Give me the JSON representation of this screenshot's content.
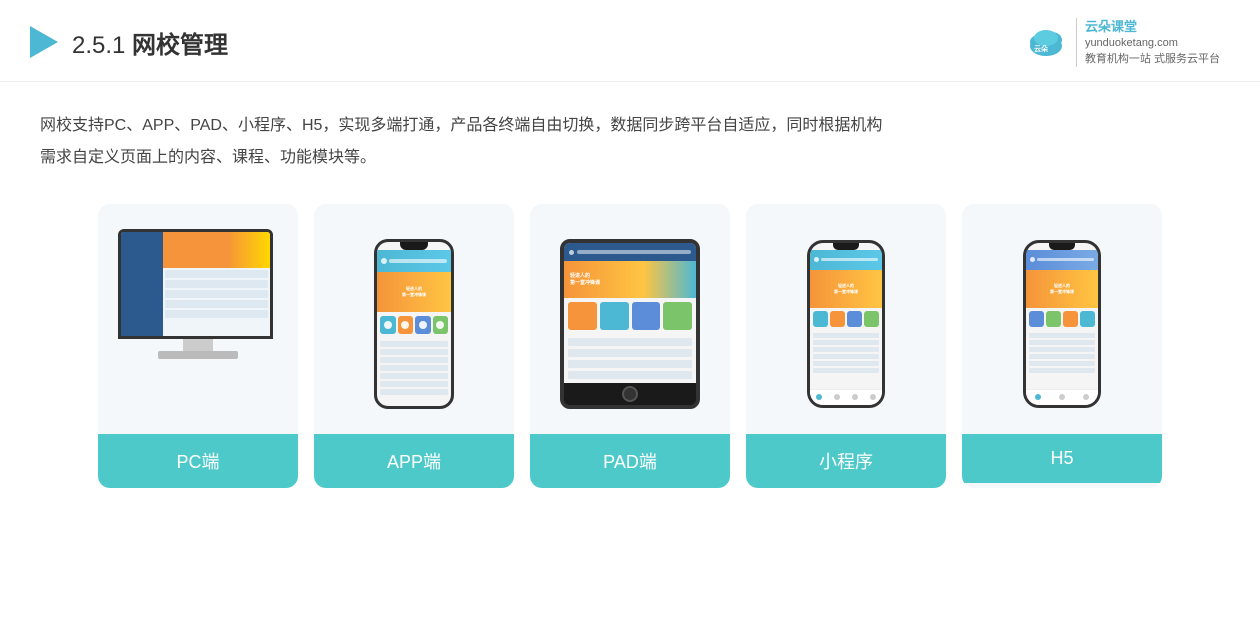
{
  "header": {
    "title_prefix": "2.5.1 ",
    "title_main": "网校管理",
    "brand": {
      "name": "云朵课堂",
      "website": "yunduoketang.com",
      "tagline1": "教育机构一站",
      "tagline2": "式服务云平台"
    }
  },
  "description": {
    "line1": "网校支持PC、APP、PAD、小程序、H5，实现多端打通，产品各终端自由切换，数据同步跨平台自适应，同时根据机构",
    "line2": "需求自定义页面上的内容、课程、功能模块等。"
  },
  "cards": [
    {
      "id": "pc",
      "label": "PC端"
    },
    {
      "id": "app",
      "label": "APP端"
    },
    {
      "id": "pad",
      "label": "PAD端"
    },
    {
      "id": "miniprogram",
      "label": "小程序"
    },
    {
      "id": "h5",
      "label": "H5"
    }
  ],
  "banner_text": "轻进人的\n第一堂冲锋课"
}
